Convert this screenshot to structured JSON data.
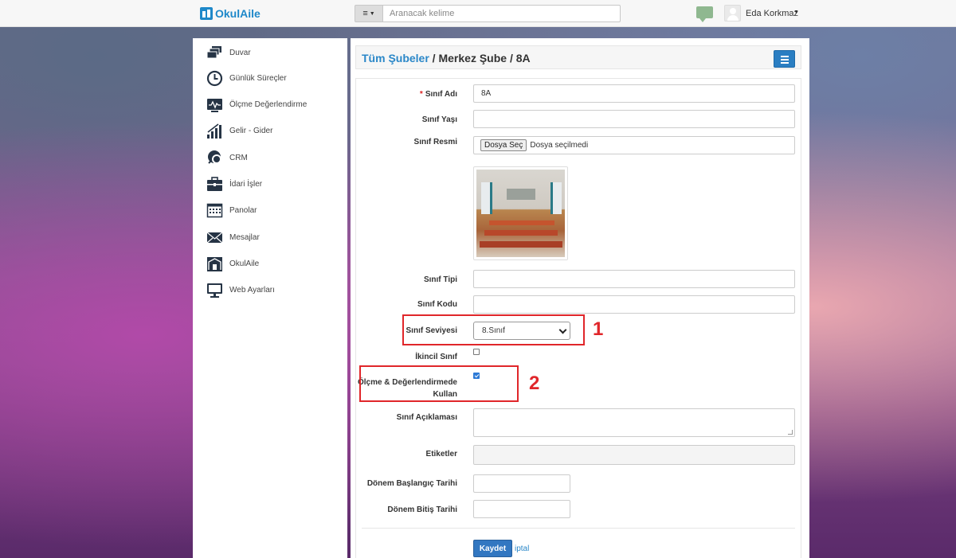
{
  "app": {
    "logo_text": "OkulAile"
  },
  "search": {
    "placeholder": "Aranacak kelime"
  },
  "user": {
    "name": "Eda Korkmaz"
  },
  "sidebar": {
    "items": [
      {
        "label": "Duvar",
        "icon": "wall-icon"
      },
      {
        "label": "Günlük Süreçler",
        "icon": "clock-icon"
      },
      {
        "label": "Ölçme Değerlendirme",
        "icon": "monitor-chart-icon"
      },
      {
        "label": "Gelir - Gider",
        "icon": "bar-chart-icon"
      },
      {
        "label": "CRM",
        "icon": "crm-chat-icon"
      },
      {
        "label": "İdari İşler",
        "icon": "briefcase-icon"
      },
      {
        "label": "Panolar",
        "icon": "calendar-board-icon"
      },
      {
        "label": "Mesajlar",
        "icon": "envelope-icon"
      },
      {
        "label": "OkulAile",
        "icon": "school-family-icon"
      },
      {
        "label": "Web Ayarları",
        "icon": "computer-icon"
      }
    ]
  },
  "breadcrumb": {
    "link": "Tüm Şubeler",
    "sep1": " / ",
    "middle": "Merkez Şube",
    "sep2": " / ",
    "current": "8A"
  },
  "form": {
    "class_name": {
      "label": "Sınıf Adı",
      "required": "*",
      "value": "8A"
    },
    "class_age": {
      "label": "Sınıf Yaşı",
      "value": ""
    },
    "class_image": {
      "label": "Sınıf Resmi",
      "button": "Dosya Seç",
      "status": "Dosya seçilmedi"
    },
    "class_type": {
      "label": "Sınıf Tipi",
      "value": ""
    },
    "class_code": {
      "label": "Sınıf Kodu",
      "value": ""
    },
    "class_level": {
      "label": "Sınıf Seviyesi",
      "value": "8.Sınıf"
    },
    "secondary_class": {
      "label": "İkincil Sınıf",
      "checked": false
    },
    "use_in_assessment": {
      "label_line1": "Ölçme & Değerlendirmede",
      "label_line2": "Kullan",
      "checked": true
    },
    "description": {
      "label": "Sınıf Açıklaması",
      "value": ""
    },
    "tags": {
      "label": "Etiketler",
      "value": ""
    },
    "term_start": {
      "label": "Dönem Başlangıç Tarihi",
      "value": ""
    },
    "term_end": {
      "label": "Dönem Bitiş Tarihi",
      "value": ""
    },
    "save_label": "Kaydet",
    "cancel_label": "iptal"
  },
  "annotations": {
    "one": "1",
    "two": "2",
    "color": "#e0262a"
  },
  "colors": {
    "brand": "#1e88c9",
    "primary_button": "#3277c1",
    "link": "#2a87c8"
  }
}
